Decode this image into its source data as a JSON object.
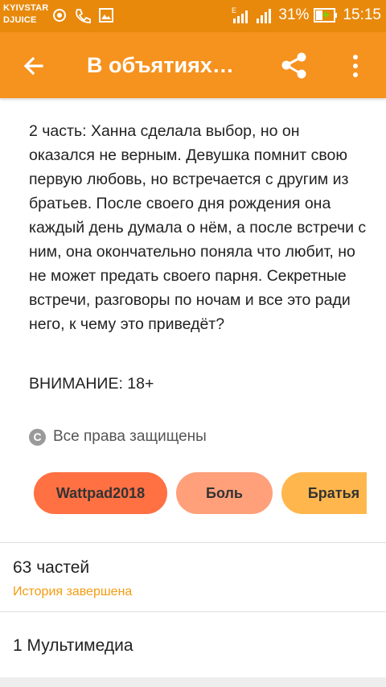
{
  "status_bar": {
    "carrier_line1": "KYIVSTAR",
    "carrier_line2": "DJUICE",
    "network": "E",
    "battery": "31%",
    "time": "15:15"
  },
  "toolbar": {
    "title": "В объятиях…",
    "back_icon": "arrow-back-icon",
    "share_icon": "share-icon",
    "more_icon": "more-vert-icon"
  },
  "description": "2 часть: Ханна сделала выбор, но он оказался не верным. Девушка помнит свою первую любовь, но встречается с другим из братьев. После своего дня рождения она каждый день думала о нём, а после встречи с ним, она окончательно поняла что любит, но не может предать своего парня. Секретные встречи, разговоры по ночам и все это ради него, к чему это приведёт?",
  "warning": "ВНИМАНИЕ: 18+",
  "copyright": {
    "icon": "C",
    "text": "Все права защищены"
  },
  "tags": [
    {
      "label": "Wattpad2018",
      "color": "#ff7043"
    },
    {
      "label": "Боль",
      "color": "#ffa07a"
    },
    {
      "label": "Братья",
      "color": "#ffb74d"
    }
  ],
  "parts": {
    "count_label": "63 частей",
    "status": "История завершена"
  },
  "media": "1 Мультимедиа",
  "colors": {
    "status_bar": "#e8890c",
    "toolbar": "#f6921e",
    "accent_text": "#f39c12"
  }
}
